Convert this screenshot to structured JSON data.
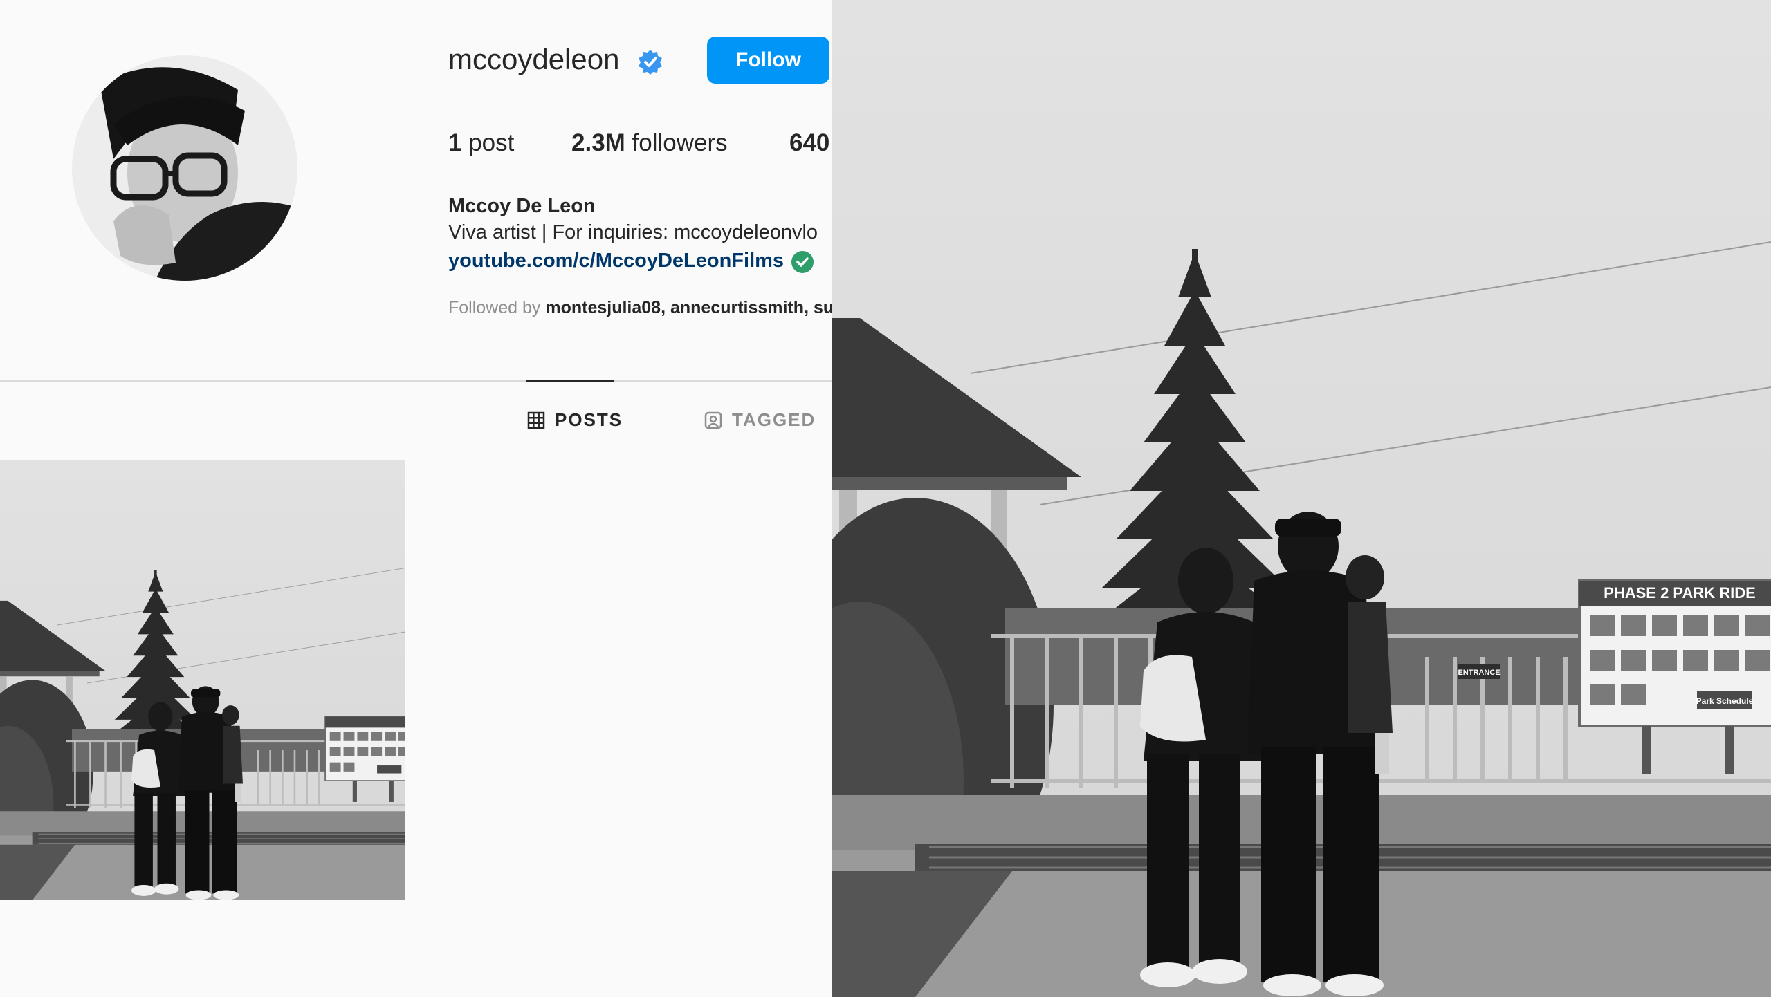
{
  "profile": {
    "username": "mccoydeleon",
    "follow_label": "Follow",
    "stats": {
      "posts_count": "1",
      "posts_label": "post",
      "followers_count": "2.3M",
      "followers_label": "followers",
      "following_count": "640"
    },
    "full_name": "Mccoy De Leon",
    "bio": "Viva artist | For inquiries: mccoydeleonvlo",
    "link": "youtube.com/c/MccoyDeLeonFilms",
    "followed_by_prefix": "Followed by",
    "followed_by_names": "montesjulia08, annecurtissmith, su"
  },
  "tabs": [
    {
      "label": "POSTS",
      "icon": "grid-icon",
      "active": true
    },
    {
      "label": "TAGGED",
      "icon": "tagged-icon",
      "active": false
    }
  ],
  "photo": {
    "sign_title": "PHASE 2 PARK RIDE",
    "entrance_sign": "ENTRANCE",
    "schedule_sign": "Park Schedule"
  },
  "colors": {
    "follow_button": "#0095f6",
    "verified_badge": "#3897f0",
    "link_text": "#00376b",
    "link_check": "#2e9e6b",
    "muted_text": "#8e8e8e"
  }
}
